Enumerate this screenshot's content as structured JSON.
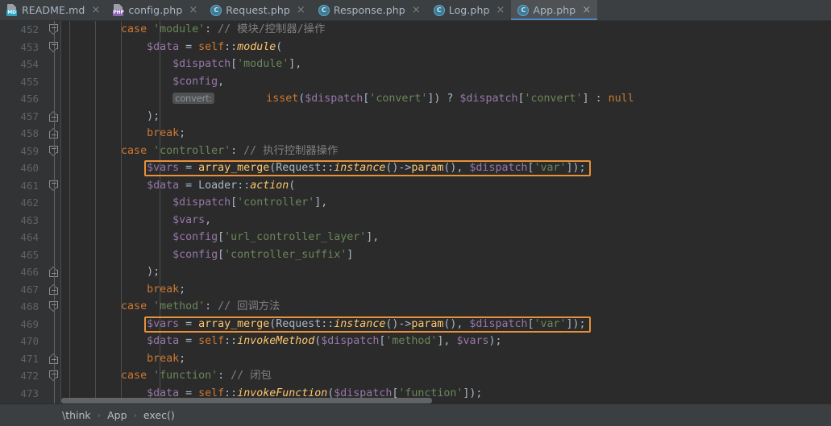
{
  "window": {
    "app": "PhpStorm Editor",
    "background": "#2b2b2b",
    "accent": "#4a88c7",
    "highlight_color": "#e8913a"
  },
  "tabs": [
    {
      "label": "README.md",
      "icon": "markdown-file-icon",
      "badge": "MD",
      "active": false,
      "close": "×"
    },
    {
      "label": "config.php",
      "icon": "php-file-icon",
      "badge": "PHP",
      "active": false,
      "close": "×"
    },
    {
      "label": "Request.php",
      "icon": "php-class-icon",
      "badge": "C",
      "active": false,
      "close": "×"
    },
    {
      "label": "Response.php",
      "icon": "php-class-icon",
      "badge": "C",
      "active": false,
      "close": "×"
    },
    {
      "label": "Log.php",
      "icon": "php-class-icon",
      "badge": "C",
      "active": false,
      "close": "×"
    },
    {
      "label": "App.php",
      "icon": "php-class-icon",
      "badge": "C",
      "active": true,
      "close": "×"
    }
  ],
  "editor": {
    "first_line": 452,
    "lines": [
      {
        "num": 452,
        "fold": "start",
        "tokens": [
          {
            "t": "        ",
            "c": "pun"
          },
          {
            "t": "case ",
            "c": "kw"
          },
          {
            "t": "'module'",
            "c": "str"
          },
          {
            "t": ":",
            "c": "pun"
          },
          {
            "t": " // 模块/控制器/操作",
            "c": "cmt"
          }
        ]
      },
      {
        "num": 453,
        "fold": "start",
        "tokens": [
          {
            "t": "            ",
            "c": "pun"
          },
          {
            "t": "$data",
            "c": "var"
          },
          {
            "t": " = ",
            "c": "op"
          },
          {
            "t": "self",
            "c": "kw"
          },
          {
            "t": "::",
            "c": "pun"
          },
          {
            "t": "module",
            "c": "mth"
          },
          {
            "t": "(",
            "c": "pun"
          }
        ]
      },
      {
        "num": 454,
        "fold": "",
        "tokens": [
          {
            "t": "                ",
            "c": "pun"
          },
          {
            "t": "$dispatch",
            "c": "var"
          },
          {
            "t": "[",
            "c": "pun"
          },
          {
            "t": "'module'",
            "c": "str"
          },
          {
            "t": "],",
            "c": "pun"
          }
        ]
      },
      {
        "num": 455,
        "fold": "",
        "tokens": [
          {
            "t": "                ",
            "c": "pun"
          },
          {
            "t": "$config",
            "c": "var"
          },
          {
            "t": ",",
            "c": "pun"
          }
        ]
      },
      {
        "num": 456,
        "fold": "",
        "hint": "convert:",
        "hint_indent": 16,
        "tokens": [
          {
            "t": "                ",
            "c": "pun"
          },
          {
            "t": "        ",
            "c": "pun"
          },
          {
            "t": "isset",
            "c": "kw"
          },
          {
            "t": "(",
            "c": "pun"
          },
          {
            "t": "$dispatch",
            "c": "var"
          },
          {
            "t": "[",
            "c": "pun"
          },
          {
            "t": "'convert'",
            "c": "str"
          },
          {
            "t": "]) ",
            "c": "pun"
          },
          {
            "t": "? ",
            "c": "op"
          },
          {
            "t": "$dispatch",
            "c": "var"
          },
          {
            "t": "[",
            "c": "pun"
          },
          {
            "t": "'convert'",
            "c": "str"
          },
          {
            "t": "] ",
            "c": "pun"
          },
          {
            "t": ": ",
            "c": "op"
          },
          {
            "t": "null",
            "c": "kw"
          }
        ]
      },
      {
        "num": 457,
        "fold": "end",
        "tokens": [
          {
            "t": "            ",
            "c": "pun"
          },
          {
            "t": ");",
            "c": "pun"
          }
        ]
      },
      {
        "num": 458,
        "fold": "end",
        "tokens": [
          {
            "t": "            ",
            "c": "pun"
          },
          {
            "t": "break",
            "c": "kw"
          },
          {
            "t": ";",
            "c": "pun"
          }
        ]
      },
      {
        "num": 459,
        "fold": "start",
        "tokens": [
          {
            "t": "        ",
            "c": "pun"
          },
          {
            "t": "case ",
            "c": "kw"
          },
          {
            "t": "'controller'",
            "c": "str"
          },
          {
            "t": ":",
            "c": "pun"
          },
          {
            "t": " // 执行控制器操作",
            "c": "cmt"
          }
        ]
      },
      {
        "num": 460,
        "fold": "",
        "highlight": true,
        "tokens": [
          {
            "t": "            ",
            "c": "pun"
          },
          {
            "t": "$vars",
            "c": "var"
          },
          {
            "t": " = ",
            "c": "op"
          },
          {
            "t": "array_merge",
            "c": "fn"
          },
          {
            "t": "(",
            "c": "pun"
          },
          {
            "t": "Request",
            "c": "cls"
          },
          {
            "t": "::",
            "c": "pun"
          },
          {
            "t": "instance",
            "c": "mth"
          },
          {
            "t": "()->",
            "c": "pun"
          },
          {
            "t": "param",
            "c": "fn"
          },
          {
            "t": "(), ",
            "c": "pun"
          },
          {
            "t": "$dispatch",
            "c": "var"
          },
          {
            "t": "[",
            "c": "pun"
          },
          {
            "t": "'var'",
            "c": "str"
          },
          {
            "t": "]);",
            "c": "pun"
          }
        ]
      },
      {
        "num": 461,
        "fold": "start",
        "tokens": [
          {
            "t": "            ",
            "c": "pun"
          },
          {
            "t": "$data",
            "c": "var"
          },
          {
            "t": " = ",
            "c": "op"
          },
          {
            "t": "Loader",
            "c": "cls"
          },
          {
            "t": "::",
            "c": "pun"
          },
          {
            "t": "action",
            "c": "mth"
          },
          {
            "t": "(",
            "c": "pun"
          }
        ]
      },
      {
        "num": 462,
        "fold": "",
        "tokens": [
          {
            "t": "                ",
            "c": "pun"
          },
          {
            "t": "$dispatch",
            "c": "var"
          },
          {
            "t": "[",
            "c": "pun"
          },
          {
            "t": "'controller'",
            "c": "str"
          },
          {
            "t": "],",
            "c": "pun"
          }
        ]
      },
      {
        "num": 463,
        "fold": "",
        "tokens": [
          {
            "t": "                ",
            "c": "pun"
          },
          {
            "t": "$vars",
            "c": "var"
          },
          {
            "t": ",",
            "c": "pun"
          }
        ]
      },
      {
        "num": 464,
        "fold": "",
        "tokens": [
          {
            "t": "                ",
            "c": "pun"
          },
          {
            "t": "$config",
            "c": "var"
          },
          {
            "t": "[",
            "c": "pun"
          },
          {
            "t": "'url_controller_layer'",
            "c": "str"
          },
          {
            "t": "],",
            "c": "pun"
          }
        ]
      },
      {
        "num": 465,
        "fold": "",
        "tokens": [
          {
            "t": "                ",
            "c": "pun"
          },
          {
            "t": "$config",
            "c": "var"
          },
          {
            "t": "[",
            "c": "pun"
          },
          {
            "t": "'controller_suffix'",
            "c": "str"
          },
          {
            "t": "]",
            "c": "pun"
          }
        ]
      },
      {
        "num": 466,
        "fold": "end",
        "tokens": [
          {
            "t": "            ",
            "c": "pun"
          },
          {
            "t": ");",
            "c": "pun"
          }
        ]
      },
      {
        "num": 467,
        "fold": "end",
        "tokens": [
          {
            "t": "            ",
            "c": "pun"
          },
          {
            "t": "break",
            "c": "kw"
          },
          {
            "t": ";",
            "c": "pun"
          }
        ]
      },
      {
        "num": 468,
        "fold": "start",
        "tokens": [
          {
            "t": "        ",
            "c": "pun"
          },
          {
            "t": "case ",
            "c": "kw"
          },
          {
            "t": "'method'",
            "c": "str"
          },
          {
            "t": ":",
            "c": "pun"
          },
          {
            "t": " // 回调方法",
            "c": "cmt"
          }
        ]
      },
      {
        "num": 469,
        "fold": "",
        "highlight": true,
        "tokens": [
          {
            "t": "            ",
            "c": "pun"
          },
          {
            "t": "$vars",
            "c": "var"
          },
          {
            "t": " = ",
            "c": "op"
          },
          {
            "t": "array_merge",
            "c": "fn"
          },
          {
            "t": "(",
            "c": "pun"
          },
          {
            "t": "Request",
            "c": "cls"
          },
          {
            "t": "::",
            "c": "pun"
          },
          {
            "t": "instance",
            "c": "mth"
          },
          {
            "t": "()->",
            "c": "pun"
          },
          {
            "t": "param",
            "c": "fn"
          },
          {
            "t": "(), ",
            "c": "pun"
          },
          {
            "t": "$dispatch",
            "c": "var"
          },
          {
            "t": "[",
            "c": "pun"
          },
          {
            "t": "'var'",
            "c": "str"
          },
          {
            "t": "]);",
            "c": "pun"
          }
        ]
      },
      {
        "num": 470,
        "fold": "",
        "tokens": [
          {
            "t": "            ",
            "c": "pun"
          },
          {
            "t": "$data",
            "c": "var"
          },
          {
            "t": " = ",
            "c": "op"
          },
          {
            "t": "self",
            "c": "kw"
          },
          {
            "t": "::",
            "c": "pun"
          },
          {
            "t": "invokeMethod",
            "c": "mth"
          },
          {
            "t": "(",
            "c": "pun"
          },
          {
            "t": "$dispatch",
            "c": "var"
          },
          {
            "t": "[",
            "c": "pun"
          },
          {
            "t": "'method'",
            "c": "str"
          },
          {
            "t": "], ",
            "c": "pun"
          },
          {
            "t": "$vars",
            "c": "var"
          },
          {
            "t": ");",
            "c": "pun"
          }
        ]
      },
      {
        "num": 471,
        "fold": "end",
        "tokens": [
          {
            "t": "            ",
            "c": "pun"
          },
          {
            "t": "break",
            "c": "kw"
          },
          {
            "t": ";",
            "c": "pun"
          }
        ]
      },
      {
        "num": 472,
        "fold": "start",
        "tokens": [
          {
            "t": "        ",
            "c": "pun"
          },
          {
            "t": "case ",
            "c": "kw"
          },
          {
            "t": "'function'",
            "c": "str"
          },
          {
            "t": ":",
            "c": "pun"
          },
          {
            "t": " // 闭包",
            "c": "cmt"
          }
        ]
      },
      {
        "num": 473,
        "fold": "",
        "clipped": true,
        "tokens": [
          {
            "t": "            ",
            "c": "pun"
          },
          {
            "t": "$data",
            "c": "var"
          },
          {
            "t": " = ",
            "c": "op"
          },
          {
            "t": "self",
            "c": "kw"
          },
          {
            "t": "::",
            "c": "pun"
          },
          {
            "t": "invokeFunction",
            "c": "mth"
          },
          {
            "t": "(",
            "c": "pun"
          },
          {
            "t": "$dispatch",
            "c": "var"
          },
          {
            "t": "[",
            "c": "pun"
          },
          {
            "t": "'function'",
            "c": "str"
          },
          {
            "t": "]);",
            "c": "pun"
          }
        ]
      }
    ]
  },
  "breadcrumb": {
    "items": [
      "\\think",
      "App",
      "exec()"
    ],
    "separator": "›"
  }
}
